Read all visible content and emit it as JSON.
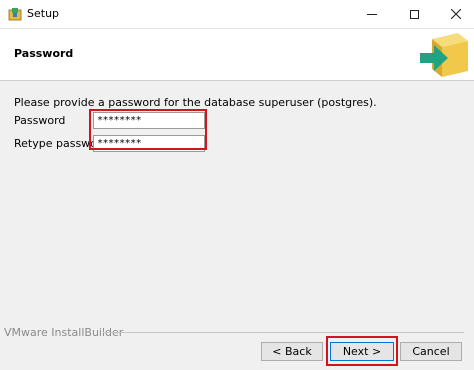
{
  "window": {
    "title": "Setup"
  },
  "header": {
    "title": "Password"
  },
  "main": {
    "instructions": "Please provide a password for the database superuser (postgres).",
    "password_label": "Password",
    "password_value": "********",
    "retype_label": "Retype password",
    "retype_value": "********"
  },
  "footer": {
    "brand": "VMware InstallBuilder",
    "back_label": "< Back",
    "next_label": "Next >",
    "cancel_label": "Cancel"
  },
  "colors": {
    "highlight": "#d3141c",
    "logo_box": "#f2c84b",
    "logo_arrow": "#21a383"
  },
  "icons": [
    "installer-icon",
    "minimize-icon",
    "maximize-icon",
    "close-icon",
    "box-arrow-logo-icon"
  ]
}
